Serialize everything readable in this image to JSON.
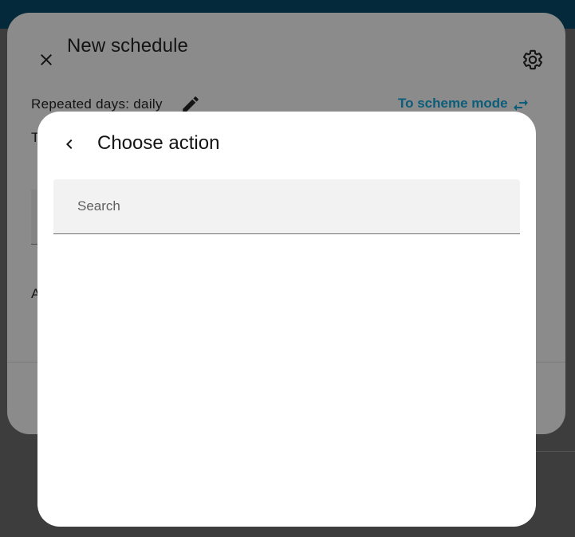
{
  "background_dialog": {
    "title": "New schedule",
    "repeated_days": "Repeated days: daily",
    "scheme_mode": "To scheme mode",
    "partial_label_1": "T",
    "partial_label_2": "A"
  },
  "action_dialog": {
    "title": "Choose action",
    "search": {
      "placeholder": "Search",
      "value": ""
    }
  },
  "icons": {
    "close": "close-icon",
    "settings": "gear-icon",
    "edit": "pencil-icon",
    "swap": "swap-horizontal-icon",
    "back": "chevron-left-icon"
  },
  "colors": {
    "accent": "#03293a",
    "link": "#0b5d7a",
    "dialog_bg": "#ffffff",
    "search_bg": "#f2f2f2"
  }
}
